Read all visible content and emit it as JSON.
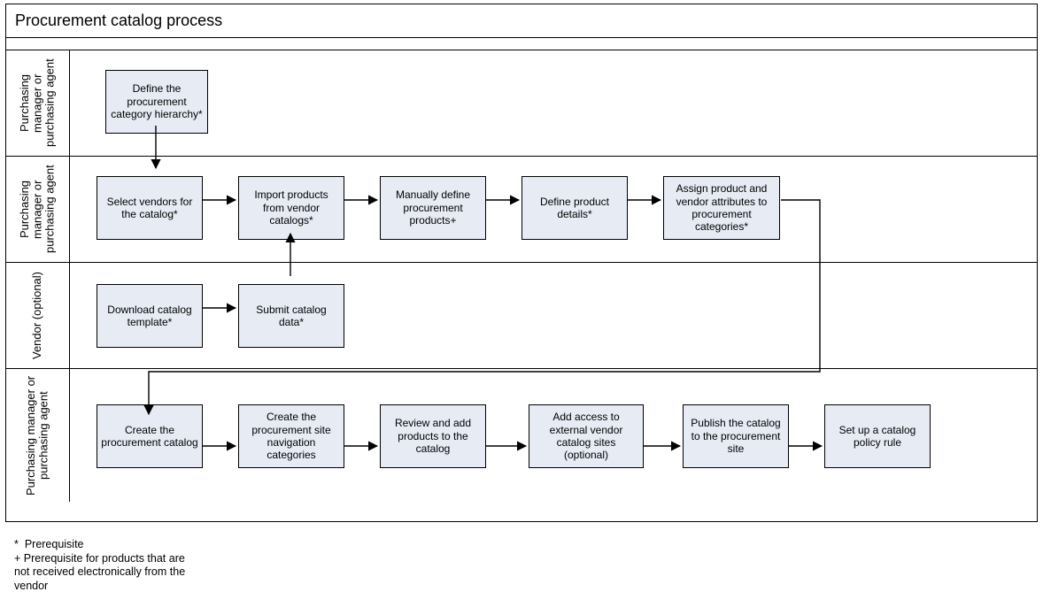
{
  "title": "Procurement catalog process",
  "lanes": [
    {
      "label": "Purchasing\nmanager or\npurchasing\nagent",
      "boxes": [
        {
          "text": "Define the procurement category hierarchy*"
        }
      ]
    },
    {
      "label": "Purchasing\nmanager or\npurchasing\nagent",
      "boxes": [
        {
          "text": "Select vendors for the catalog*"
        },
        {
          "text": "Import products from vendor catalogs*"
        },
        {
          "text": "Manually define procurement products+"
        },
        {
          "text": "Define product details*"
        },
        {
          "text": "Assign product and vendor attributes to procurement categories*"
        }
      ]
    },
    {
      "label": "Vendor\n(optional)",
      "boxes": [
        {
          "text": "Download catalog template*"
        },
        {
          "text": "Submit catalog data*"
        }
      ]
    },
    {
      "label": "Purchasing\nmanager or\npurchasing agent",
      "boxes": [
        {
          "text": "Create the procurement catalog"
        },
        {
          "text": "Create the procurement site navigation categories"
        },
        {
          "text": "Review and add products to the catalog"
        },
        {
          "text": "Add access to external vendor catalog sites (optional)"
        },
        {
          "text": "Publish the catalog to the procurement site"
        },
        {
          "text": "Set up a catalog policy rule"
        }
      ]
    }
  ],
  "legend": {
    "star": "Prerequisite",
    "plus": "Prerequisite for products that are not received electronically from the vendor"
  }
}
